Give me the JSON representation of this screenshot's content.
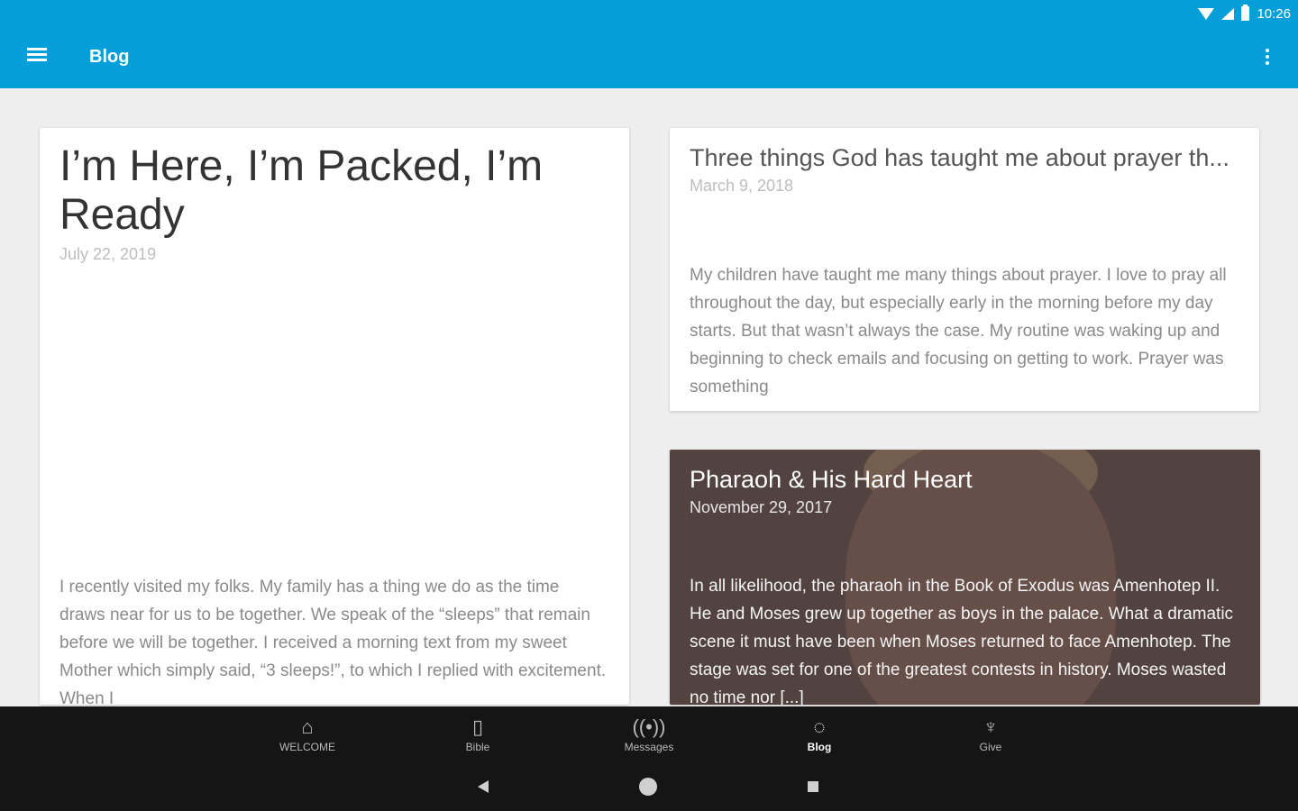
{
  "status_bar": {
    "time": "10:26"
  },
  "app_bar": {
    "title": "Blog"
  },
  "posts": [
    {
      "title": "I’m Here, I’m Packed, I’m Ready",
      "date": "July 22, 2019",
      "excerpt": "I recently visited my folks.  My family has a thing we do as the time draws near for us to be together.  We speak of the “sleeps” that remain before we will be together.  I received a morning text from my sweet Mother which simply said, “3 sleeps!”, to which I replied with excitement. When I"
    },
    {
      "title": "Three things God has taught me about prayer th...",
      "date": "March 9, 2018",
      "excerpt": "My children have taught me many things about prayer.  I love to pray all throughout the day, but especially early in the morning before my day starts.  But that wasn’t always the case.  My routine was waking up and beginning to check emails and focusing on getting to work. Prayer was something"
    },
    {
      "title": "Pharaoh & His Hard Heart",
      "date": "November 29, 2017",
      "excerpt": "In all likelihood, the pharaoh in the Book of Exodus was Amenhotep II. He and Moses grew up together as boys in the palace. What a dramatic scene it must have been when Moses returned to face Amenhotep. The stage was set for one of the greatest contests in history. Moses wasted no time nor [...]"
    }
  ],
  "bottom_nav": [
    {
      "label": "WELCOME",
      "icon": "home-icon",
      "active": false
    },
    {
      "label": "Bible",
      "icon": "book-icon",
      "active": false
    },
    {
      "label": "Messages",
      "icon": "broadcast-icon",
      "active": false
    },
    {
      "label": "Blog",
      "icon": "chat-bubble-icon",
      "active": true
    },
    {
      "label": "Give",
      "icon": "give-icon",
      "active": false
    }
  ],
  "colors": {
    "app_bar": "#049fd9",
    "background": "#eeeeee",
    "nav_bar": "#151515"
  }
}
